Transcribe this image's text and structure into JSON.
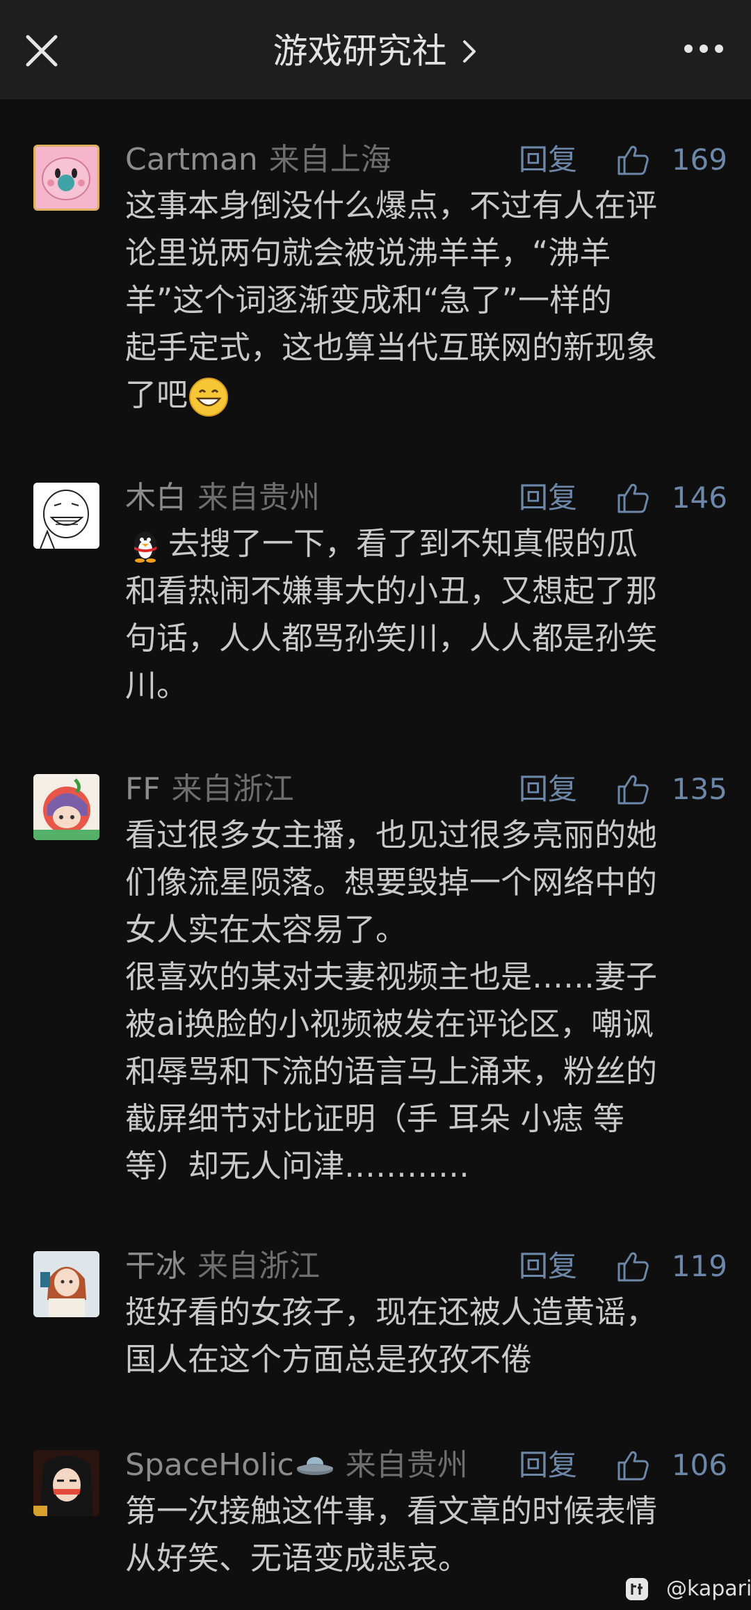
{
  "header": {
    "title": "游戏研究社"
  },
  "actions": {
    "reply_label": "回复"
  },
  "comments": [
    {
      "username": "Cartman",
      "location": "来自上海",
      "likes": "169",
      "lines": [
        "这事本身倒没什么爆点，不过有人在评",
        "论里说两句就会被说沸羊羊，“沸羊",
        "羊”这个词逐渐变成和“急了”一样的",
        "起手定式，这也算当代互联网的新现象",
        "了吧"
      ],
      "emoji": "grinning-face-emoji"
    },
    {
      "username": "木白",
      "location": "来自贵州",
      "likes": "146",
      "lead_emoji": "penguin-emoji",
      "lines": [
        "去搜了一下，看了到不知真假的瓜",
        "和看热闹不嫌事大的小丑，又想起了那",
        "句话，人人都骂孙笑川，人人都是孙笑",
        "川。"
      ]
    },
    {
      "username": "FF",
      "location": "来自浙江",
      "likes": "135",
      "lines": [
        "看过很多女主播，也见过很多亮丽的她",
        "们像流星陨落。想要毁掉一个网络中的",
        "女人实在太容易了。",
        "很喜欢的某对夫妻视频主也是……妻子",
        "被ai换脸的小视频被发在评论区，嘲讽",
        "和辱骂和下流的语言马上涌来，粉丝的",
        "截屏细节对比证明（手 耳朵 小痣 等",
        "等）却无人问津…………"
      ]
    },
    {
      "username": "干冰",
      "location": "来自浙江",
      "likes": "119",
      "lines": [
        "挺好看的女孩子，现在还被人造黄谣，",
        "国人在这个方面总是孜孜不倦"
      ]
    },
    {
      "username": "SpaceHolic",
      "name_emoji": "ufo-emoji",
      "location": "来自贵州",
      "likes": "106",
      "lines": [
        "第一次接触这件事，看文章的时候表情",
        "从好笑、无语变成悲哀。"
      ]
    }
  ],
  "watermark": {
    "icon": "tieba-icon",
    "text": "@kapari"
  },
  "colors": {
    "background": "#0f0f0f",
    "header": "#1e1e1e",
    "accent": "#6d87a8"
  }
}
